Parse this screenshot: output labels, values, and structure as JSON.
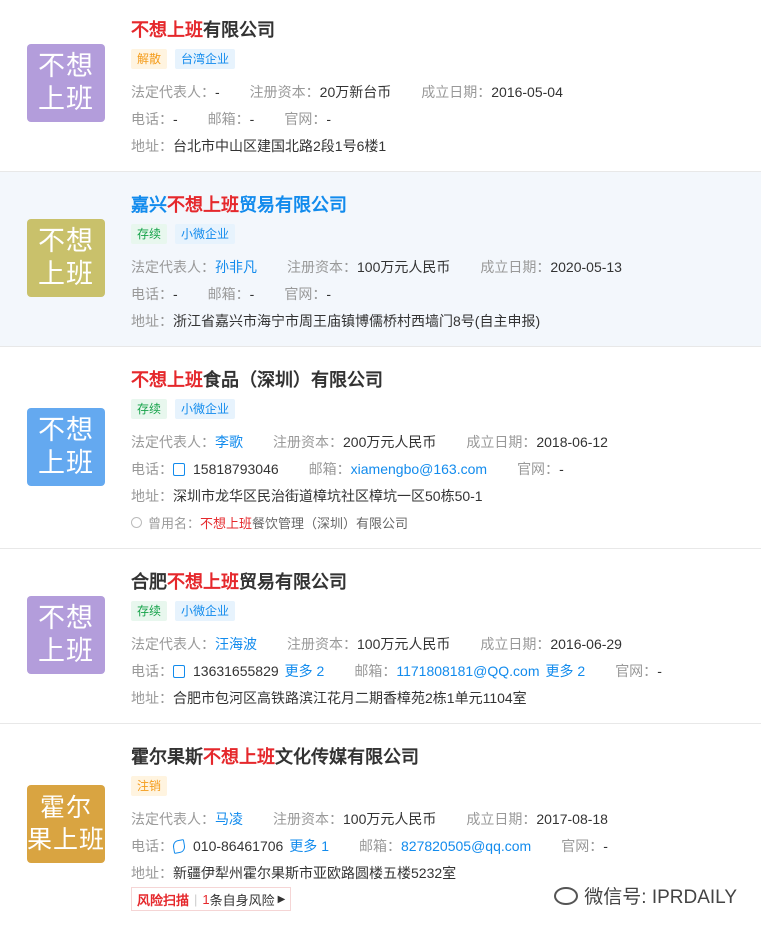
{
  "companies": [
    {
      "logo_lines": [
        "不想",
        "上班"
      ],
      "logo_color": "#b39ddb",
      "title_prefix": "",
      "title_kw": "不想上班",
      "title_suffix": "有限公司",
      "tags": [
        "解散",
        "台湾企业"
      ],
      "legal_label": "法定代表人：",
      "legal_value": "-",
      "capital_label": "注册资本：",
      "capital_value": "20万新台币",
      "date_label": "成立日期：",
      "date_value": "2016-05-04",
      "phone_label": "电话：",
      "phone_value": "-",
      "email_label": "邮箱：",
      "email_value": "-",
      "web_label": "官网：",
      "web_value": "-",
      "addr_label": "地址：",
      "addr_value": "台北市中山区建国北路2段1号6楼1"
    },
    {
      "logo_lines": [
        "不想",
        "上班"
      ],
      "logo_color": "#c9c16b",
      "title_prefix": "嘉兴",
      "title_kw": "不想上班",
      "title_suffix": "贸易有限公司",
      "tags": [
        "存续",
        "小微企业"
      ],
      "legal_label": "法定代表人：",
      "legal_value": "孙非凡",
      "capital_label": "注册资本：",
      "capital_value": "100万元人民币",
      "date_label": "成立日期：",
      "date_value": "2020-05-13",
      "phone_label": "电话：",
      "phone_value": "-",
      "email_label": "邮箱：",
      "email_value": "-",
      "web_label": "官网：",
      "web_value": "-",
      "addr_label": "地址：",
      "addr_value": "浙江省嘉兴市海宁市周王庙镇博儒桥村西墙门8号(自主申报)"
    },
    {
      "logo_lines": [
        "不想",
        "上班"
      ],
      "logo_color": "#64a9f0",
      "title_prefix": "",
      "title_kw": "不想上班",
      "title_suffix": "食品（深圳）有限公司",
      "tags": [
        "存续",
        "小微企业"
      ],
      "legal_label": "法定代表人：",
      "legal_value": "李歌",
      "capital_label": "注册资本：",
      "capital_value": "200万元人民币",
      "date_label": "成立日期：",
      "date_value": "2018-06-12",
      "phone_label": "电话：",
      "phone_value": "15818793046",
      "email_label": "邮箱：",
      "email_value": "xiamengbo@163.com",
      "web_label": "官网：",
      "web_value": "-",
      "addr_label": "地址：",
      "addr_value": "深圳市龙华区民治街道樟坑社区樟坑一区50栋50-1",
      "alias_label": "曾用名：",
      "alias_kw": "不想上班",
      "alias_rest": "餐饮管理（深圳）有限公司"
    },
    {
      "logo_lines": [
        "不想",
        "上班"
      ],
      "logo_color": "#b39ddb",
      "title_prefix": "合肥",
      "title_kw": "不想上班",
      "title_suffix": "贸易有限公司",
      "tags": [
        "存续",
        "小微企业"
      ],
      "legal_label": "法定代表人：",
      "legal_value": "汪海波",
      "capital_label": "注册资本：",
      "capital_value": "100万元人民币",
      "date_label": "成立日期：",
      "date_value": "2016-06-29",
      "phone_label": "电话：",
      "phone_value": "13631655829",
      "phone_more": "更多 2",
      "email_label": "邮箱：",
      "email_value": "1171808181@QQ.com",
      "email_more": "更多 2",
      "web_label": "官网：",
      "web_value": "-",
      "addr_label": "地址：",
      "addr_value": "合肥市包河区高铁路滨江花月二期香樟苑2栋1单元1104室"
    },
    {
      "logo_lines": [
        "霍尔",
        "果上班"
      ],
      "logo_color": "#d9a441",
      "title_prefix": "霍尔果斯",
      "title_kw": "不想上班",
      "title_suffix": "文化传媒有限公司",
      "tags": [
        "注销"
      ],
      "legal_label": "法定代表人：",
      "legal_value": "马凌",
      "capital_label": "注册资本：",
      "capital_value": "100万元人民币",
      "date_label": "成立日期：",
      "date_value": "2017-08-18",
      "phone_label": "电话：",
      "phone_value": "010-86461706",
      "phone_more": "更多 1",
      "email_label": "邮箱：",
      "email_value": "827820505@qq.com",
      "web_label": "官网：",
      "web_value": "-",
      "addr_label": "地址：",
      "addr_value": "新疆伊犁州霍尔果斯市亚欧路圆楼五楼5232室",
      "risk_label": "风险扫描",
      "risk_count": "1",
      "risk_text": "条自身风险"
    }
  ],
  "watermark": "微信号: IPRDAILY"
}
